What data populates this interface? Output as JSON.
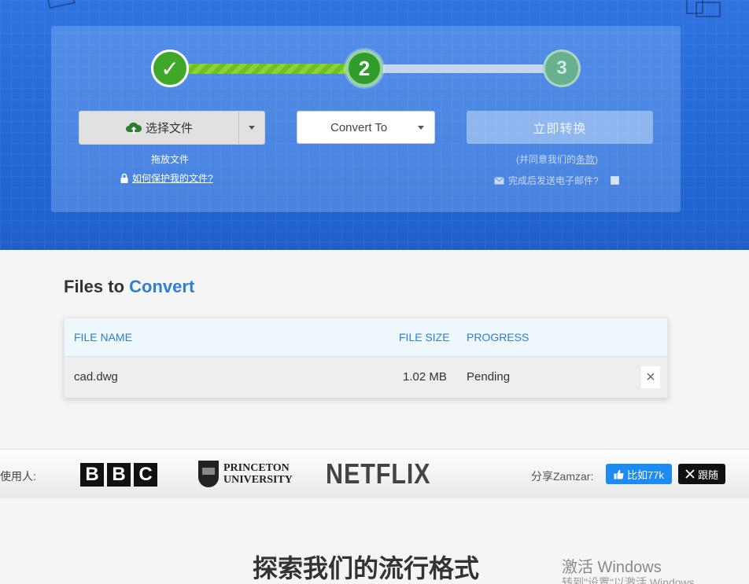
{
  "hero": {
    "steps": [
      "✓",
      "2",
      "3"
    ],
    "choose_files": "选择文件",
    "convert_to": "Convert To",
    "convert_now": "立即转换",
    "drop_files": "拖放文件",
    "protect_link": "如何保护我的文件?",
    "terms_prefix": "(并同意我们的",
    "terms_link": "条款",
    "terms_suffix": ")",
    "email_label": "完成后发送电子邮件?"
  },
  "files": {
    "title_prefix": "Files to",
    "title_highlight": "Convert",
    "columns": [
      "FILE NAME",
      "FILE SIZE",
      "PROGRESS"
    ],
    "rows": [
      {
        "name": "cad.dwg",
        "size": "1.02 MB",
        "progress": "Pending"
      }
    ],
    "remove_symbol": "×"
  },
  "logos": {
    "used_by": "使用人:",
    "bbc": [
      "B",
      "B",
      "C"
    ],
    "princeton_line1": "PRINCETON",
    "princeton_line2": "UNIVERSITY",
    "netflix": "NETFLIX",
    "share_label": "分享Zamzar:",
    "facebook_label": "比如77k",
    "x_label": "跟随"
  },
  "explore_title": "探索我们的流行格式",
  "watermark": {
    "line1": "激活 Windows",
    "line2": "转到\"设置\"以激活 Windows"
  },
  "colors": {
    "brand_blue": "#2c7ed6",
    "hero_blue": "#2468d6",
    "step_green": "#3fa82a",
    "facebook": "#1d8bf1"
  }
}
